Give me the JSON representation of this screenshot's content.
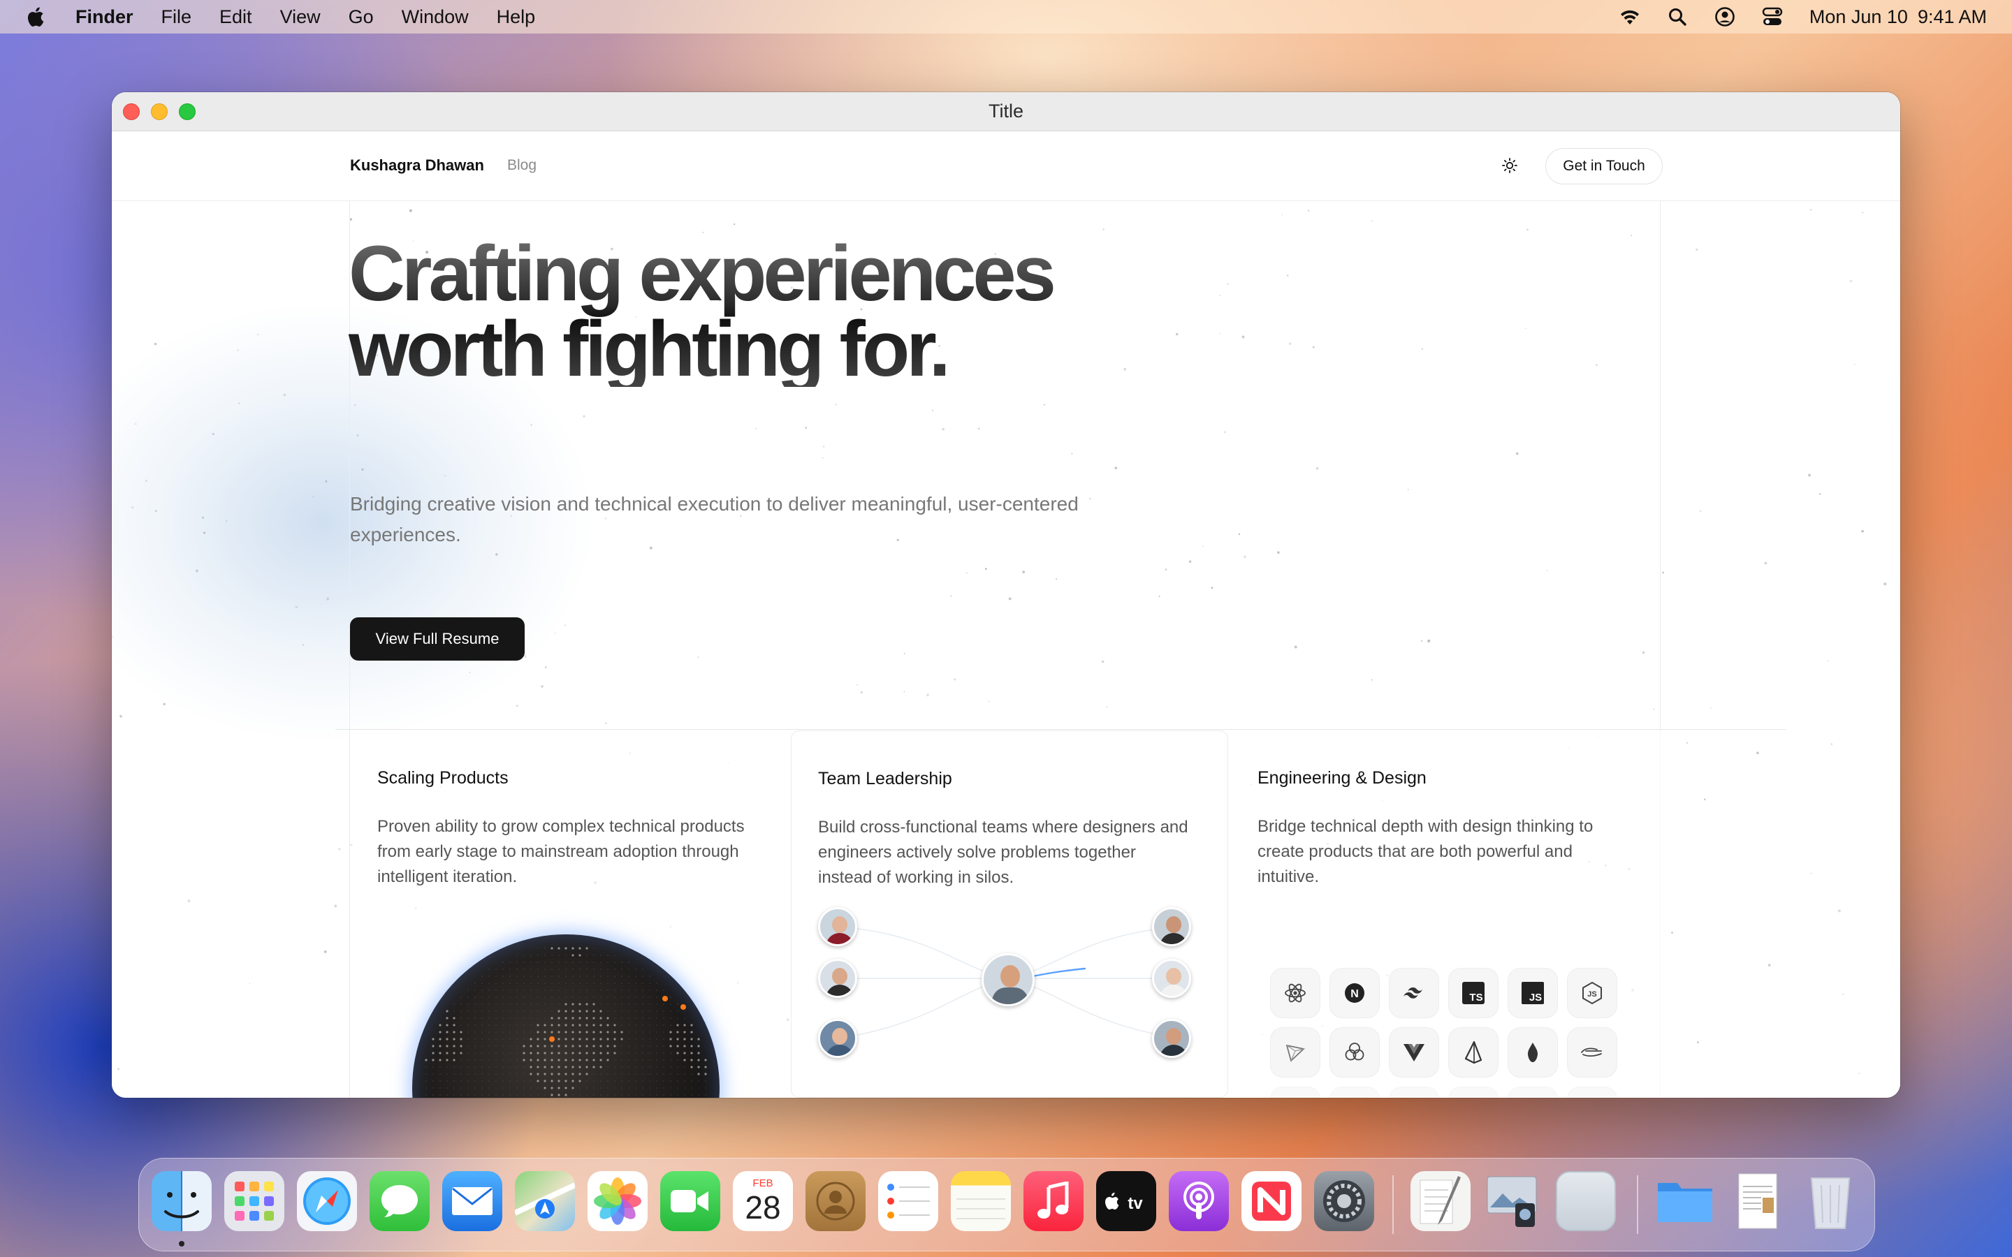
{
  "menubar": {
    "app_name": "Finder",
    "items": [
      "File",
      "Edit",
      "View",
      "Go",
      "Window",
      "Help"
    ],
    "clock_date": "Mon Jun 10",
    "clock_time": "9:41 AM",
    "status_icons": [
      "wifi-icon",
      "search-icon",
      "user-icon",
      "control-center-icon"
    ]
  },
  "window": {
    "title": "Title"
  },
  "site": {
    "brand": "Kushagra Dhawan",
    "nav_blog": "Blog",
    "contact_button": "Get in Touch",
    "hero_line1": "Crafting experiences",
    "hero_line2": "worth fighting for.",
    "hero_subtitle": "Bridging creative vision and technical execution to deliver meaningful, user-centered experiences.",
    "resume_button": "View Full Resume"
  },
  "cards": [
    {
      "title": "Scaling Products",
      "description": "Proven ability to grow complex technical products from early stage to mainstream adoption through intelligent iteration."
    },
    {
      "title": "Team Leadership",
      "description": "Build cross-functional teams where designers and engineers actively solve problems together instead of working in silos."
    },
    {
      "title": "Engineering & Design",
      "description": "Bridge technical depth with design thinking to create products that are both powerful and intuitive."
    }
  ],
  "tech_icons": [
    "react-icon",
    "nextjs-icon",
    "tailwind-icon",
    "typescript-icon",
    "javascript-icon",
    "nodejs-icon",
    "triangle-icon",
    "openai-icon",
    "vue-icon",
    "prisma-icon",
    "drop-icon",
    "framer-icon"
  ],
  "tech_labels": {
    "ts": "TS",
    "js": "JS",
    "next": "N"
  },
  "calendar": {
    "month": "FEB",
    "day": "28"
  },
  "appletv_label": "tv",
  "dock": [
    "Finder",
    "Launchpad",
    "Safari",
    "Messages",
    "Mail",
    "Maps",
    "Photos",
    "FaceTime",
    "Calendar",
    "Contacts",
    "Reminders",
    "Notes",
    "Music",
    "TV",
    "Podcasts",
    "News",
    "System Settings",
    "TextEdit",
    "Preview",
    "Blank",
    "Downloads",
    "Document",
    "Trash"
  ]
}
